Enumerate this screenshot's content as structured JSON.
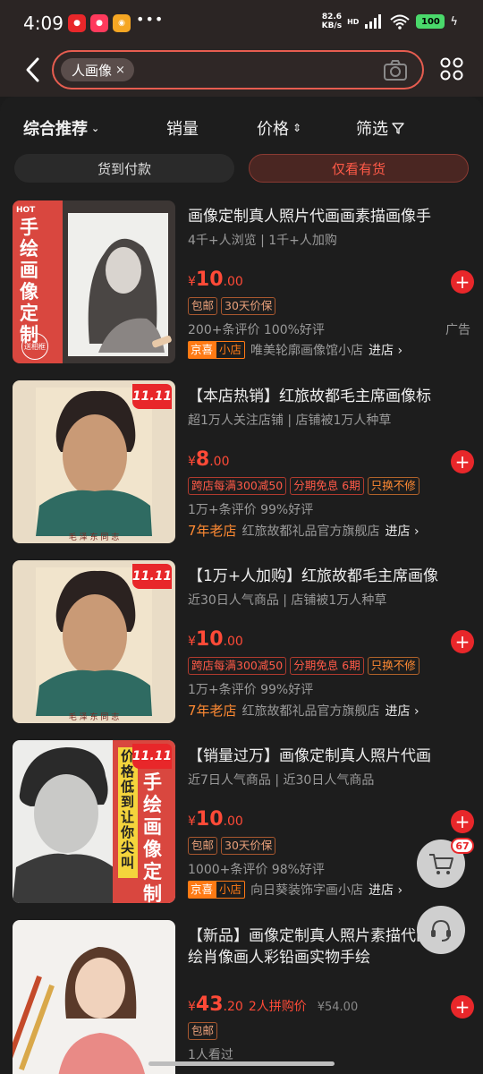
{
  "status_bar": {
    "time": "4:09",
    "dots": "•••",
    "net_speed_value": "82.6",
    "net_speed_unit": "KB/s",
    "hd": "HD",
    "battery": "100"
  },
  "search": {
    "chip_text": "人画像",
    "chip_close": "×"
  },
  "sort": {
    "comprehensive": "综合推荐",
    "sales": "销量",
    "price": "价格",
    "filter": "筛选"
  },
  "filters": {
    "cod": "货到付款",
    "in_stock": "仅看有货"
  },
  "products": [
    {
      "title": "画像定制真人照片代画画素描画像手",
      "sub": "4千+人浏览 | 1千+人加购",
      "currency": "¥",
      "price_int": "10",
      "price_dec": ".00",
      "tags": [
        "包邮",
        "30天价保"
      ],
      "rating": "200+条评价  100%好评",
      "ad": "广告",
      "shop_badge_a": "京喜",
      "shop_badge_b": "小店",
      "shop": "唯美轮廓画像馆小店",
      "enter": "进店 ›",
      "thumb_text": "手绘画像定制",
      "thumb_hot": "HOT",
      "thumb_gift": "送相框"
    },
    {
      "title": "【本店热销】红旅故都毛主席画像标",
      "sub": "超1万人关注店铺 | 店铺被1万人种草",
      "currency": "¥",
      "price_int": "8",
      "price_dec": ".00",
      "tags": [
        "跨店每满300减50",
        "分期免息 6期",
        "只换不修"
      ],
      "rating": "1万+条评价  99%好评",
      "old_shop": "7年老店",
      "shop": "红旅故都礼品官方旗舰店",
      "enter": "进店 ›",
      "badge": "11.11",
      "caption": "毛 泽 东 同 志"
    },
    {
      "title": "【1万+人加购】红旅故都毛主席画像",
      "sub": "近30日人气商品 | 店铺被1万人种草",
      "currency": "¥",
      "price_int": "10",
      "price_dec": ".00",
      "tags": [
        "跨店每满300减50",
        "分期免息 6期",
        "只换不修"
      ],
      "rating": "1万+条评价  99%好评",
      "old_shop": "7年老店",
      "shop": "红旅故都礼品官方旗舰店",
      "enter": "进店 ›",
      "badge": "11.11",
      "caption": "毛 泽 东 同 志"
    },
    {
      "title": "【销量过万】画像定制真人照片代画",
      "sub": "近7日人气商品 | 近30日人气商品",
      "currency": "¥",
      "price_int": "10",
      "price_dec": ".00",
      "tags": [
        "包邮",
        "30天价保"
      ],
      "rating": "1000+条评价  98%好评",
      "shop_badge_a": "京喜",
      "shop_badge_b": "小店",
      "shop": "向日葵装饰字画小店",
      "enter": "进店 ›",
      "badge": "11.11",
      "thumb_text": "手绘画像定制",
      "thumb_yellow": "价格低到让你尖叫"
    },
    {
      "title": "【新品】画像定制真人照片素描代画画手绘肖像画人彩铅画实物手绘",
      "currency": "¥",
      "price_int": "43",
      "price_dec": ".20",
      "group_label": "2人拼购价",
      "orig_price": "¥54.00",
      "tags": [
        "包邮"
      ],
      "rating": "1人看过"
    }
  ],
  "cart": {
    "count": "67"
  },
  "colors": {
    "accent": "#e8272a",
    "price": "#ff4a37",
    "search_border": "#e75d50"
  }
}
